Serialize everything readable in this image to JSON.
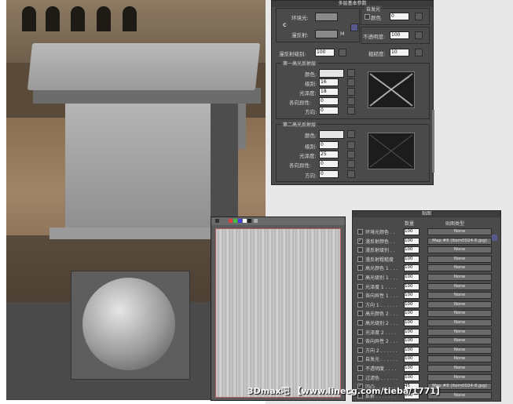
{
  "top_panel": {
    "title": "多层基本参数",
    "ambient_label": "环境光:",
    "lock_btn": "C",
    "diffuse_label": "漫反射:",
    "diffuse_map": "M",
    "self_illum_label": "自发光",
    "color_label": "颜色",
    "self_illum_value": "0",
    "opacity_label": "不透明度:",
    "opacity_value": "100",
    "diff_level_label": "漫反射级别:",
    "diff_level_value": "100",
    "roughness_label": "粗糙度:",
    "roughness_value": "10",
    "spec1": {
      "title": "第一高光反射层",
      "color_label": "颜色:",
      "level_label": "级别:",
      "level_value": "16",
      "gloss_label": "光泽度:",
      "gloss_value": "18",
      "aniso_label": "各向异性:",
      "aniso_value": "0",
      "orient_label": "方向:",
      "orient_value": "0"
    },
    "spec2": {
      "title": "第二高光反射层",
      "color_label": "颜色:",
      "level_label": "级别:",
      "level_value": "0",
      "gloss_label": "光泽度:",
      "gloss_value": "25",
      "aniso_label": "各向异性:",
      "aniso_value": "0",
      "orient_label": "方向:",
      "orient_value": "0"
    }
  },
  "maps_panel": {
    "title": "贴图",
    "col_amount": "数量",
    "col_type": "贴图类型",
    "rows": [
      {
        "name": "环境光颜色 . .",
        "amount": "100",
        "map": "None",
        "checked": false
      },
      {
        "name": "漫反射颜色 . .",
        "amount": "100",
        "map": "Map #6 (Item0024-6.jpg)",
        "checked": true
      },
      {
        "name": "漫反射级别 . .",
        "amount": "100",
        "map": "None",
        "checked": false
      },
      {
        "name": "漫反射粗糙度",
        "amount": "100",
        "map": "None",
        "checked": false
      },
      {
        "name": "高光颜色 1 . . .",
        "amount": "100",
        "map": "None",
        "checked": false
      },
      {
        "name": "高光级别 1 . . .",
        "amount": "100",
        "map": "None",
        "checked": false
      },
      {
        "name": "光泽度 1 . . . .",
        "amount": "100",
        "map": "None",
        "checked": false
      },
      {
        "name": "各向异性 1 . . .",
        "amount": "100",
        "map": "None",
        "checked": false
      },
      {
        "name": "方向 1 . . . . . .",
        "amount": "100",
        "map": "None",
        "checked": false
      },
      {
        "name": "高光颜色 2 . . .",
        "amount": "100",
        "map": "None",
        "checked": false
      },
      {
        "name": "高光级别 2 . . .",
        "amount": "100",
        "map": "None",
        "checked": false
      },
      {
        "name": "光泽度 2 . . . .",
        "amount": "100",
        "map": "None",
        "checked": false
      },
      {
        "name": "各向异性 2 . . .",
        "amount": "100",
        "map": "None",
        "checked": false
      },
      {
        "name": "方向 2 . . . . . .",
        "amount": "100",
        "map": "None",
        "checked": false
      },
      {
        "name": "自发光 . . . . . .",
        "amount": "100",
        "map": "None",
        "checked": false
      },
      {
        "name": "不透明度 . . . .",
        "amount": "100",
        "map": "None",
        "checked": false
      },
      {
        "name": "过滤色 . . . . . .",
        "amount": "100",
        "map": "None",
        "checked": false
      },
      {
        "name": "凹凸 . . . . . . . .",
        "amount": "45",
        "map": "Map #8 (Item0024-8.jpg)",
        "checked": true
      },
      {
        "name": "反射 . . . . . . .",
        "amount": "100",
        "map": "None",
        "checked": false
      }
    ]
  },
  "watermark": "3Dmax吧 【www.linecg.com/tieba/1771】"
}
